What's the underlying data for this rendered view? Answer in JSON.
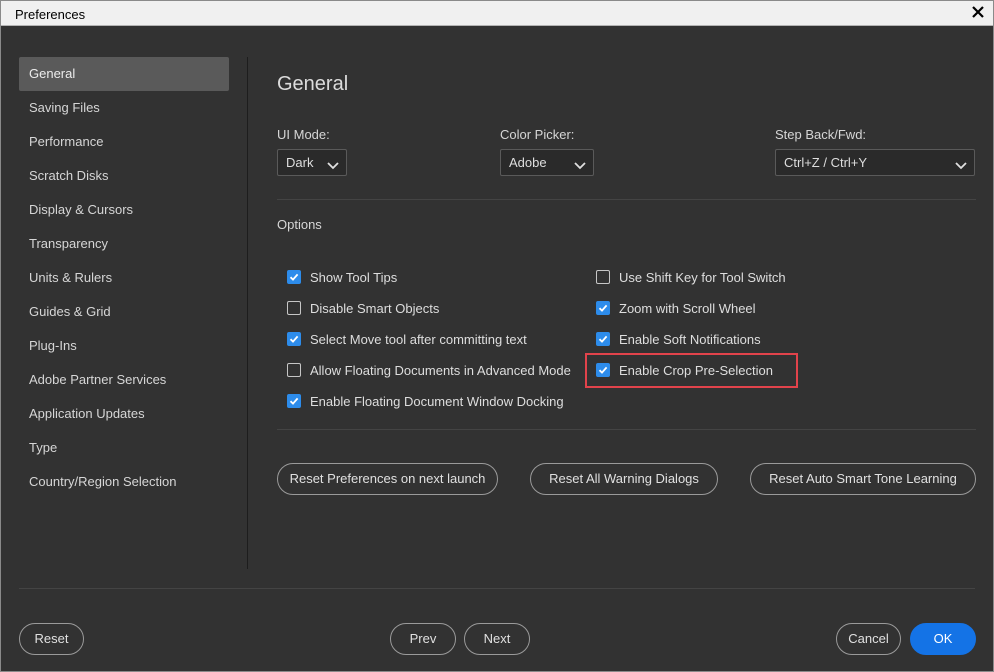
{
  "window": {
    "title": "Preferences"
  },
  "sidebar": {
    "items": [
      {
        "label": "General",
        "active": true
      },
      {
        "label": "Saving Files"
      },
      {
        "label": "Performance"
      },
      {
        "label": "Scratch Disks"
      },
      {
        "label": "Display & Cursors"
      },
      {
        "label": "Transparency"
      },
      {
        "label": "Units & Rulers"
      },
      {
        "label": "Guides & Grid"
      },
      {
        "label": "Plug-Ins"
      },
      {
        "label": "Adobe Partner Services"
      },
      {
        "label": "Application Updates"
      },
      {
        "label": "Type"
      },
      {
        "label": "Country/Region Selection"
      }
    ]
  },
  "main": {
    "title": "General",
    "ui_mode": {
      "label": "UI Mode:",
      "value": "Dark"
    },
    "color_picker": {
      "label": "Color Picker:",
      "value": "Adobe"
    },
    "step_back": {
      "label": "Step Back/Fwd:",
      "value": "Ctrl+Z / Ctrl+Y"
    },
    "options_label": "Options",
    "options_left": [
      {
        "label": "Show Tool Tips",
        "checked": true
      },
      {
        "label": "Disable Smart Objects",
        "checked": false
      },
      {
        "label": "Select Move tool after committing text",
        "checked": true
      },
      {
        "label": "Allow Floating Documents in Advanced Mode",
        "checked": false
      },
      {
        "label": "Enable Floating Document Window Docking",
        "checked": true
      }
    ],
    "options_right": [
      {
        "label": "Use Shift Key for Tool Switch",
        "checked": false
      },
      {
        "label": "Zoom with Scroll Wheel",
        "checked": true
      },
      {
        "label": "Enable Soft Notifications",
        "checked": true
      },
      {
        "label": "Enable Crop Pre-Selection",
        "checked": true
      }
    ],
    "buttons": {
      "reset_prefs": "Reset Preferences on next launch",
      "reset_warnings": "Reset All Warning Dialogs",
      "reset_smart_tone": "Reset Auto Smart Tone Learning"
    }
  },
  "footer": {
    "reset": "Reset",
    "prev": "Prev",
    "next": "Next",
    "cancel": "Cancel",
    "ok": "OK"
  },
  "colors": {
    "accent": "#1473e6",
    "checkbox": "#2d8ceb",
    "highlight": "#e2434b",
    "background": "#323232"
  }
}
